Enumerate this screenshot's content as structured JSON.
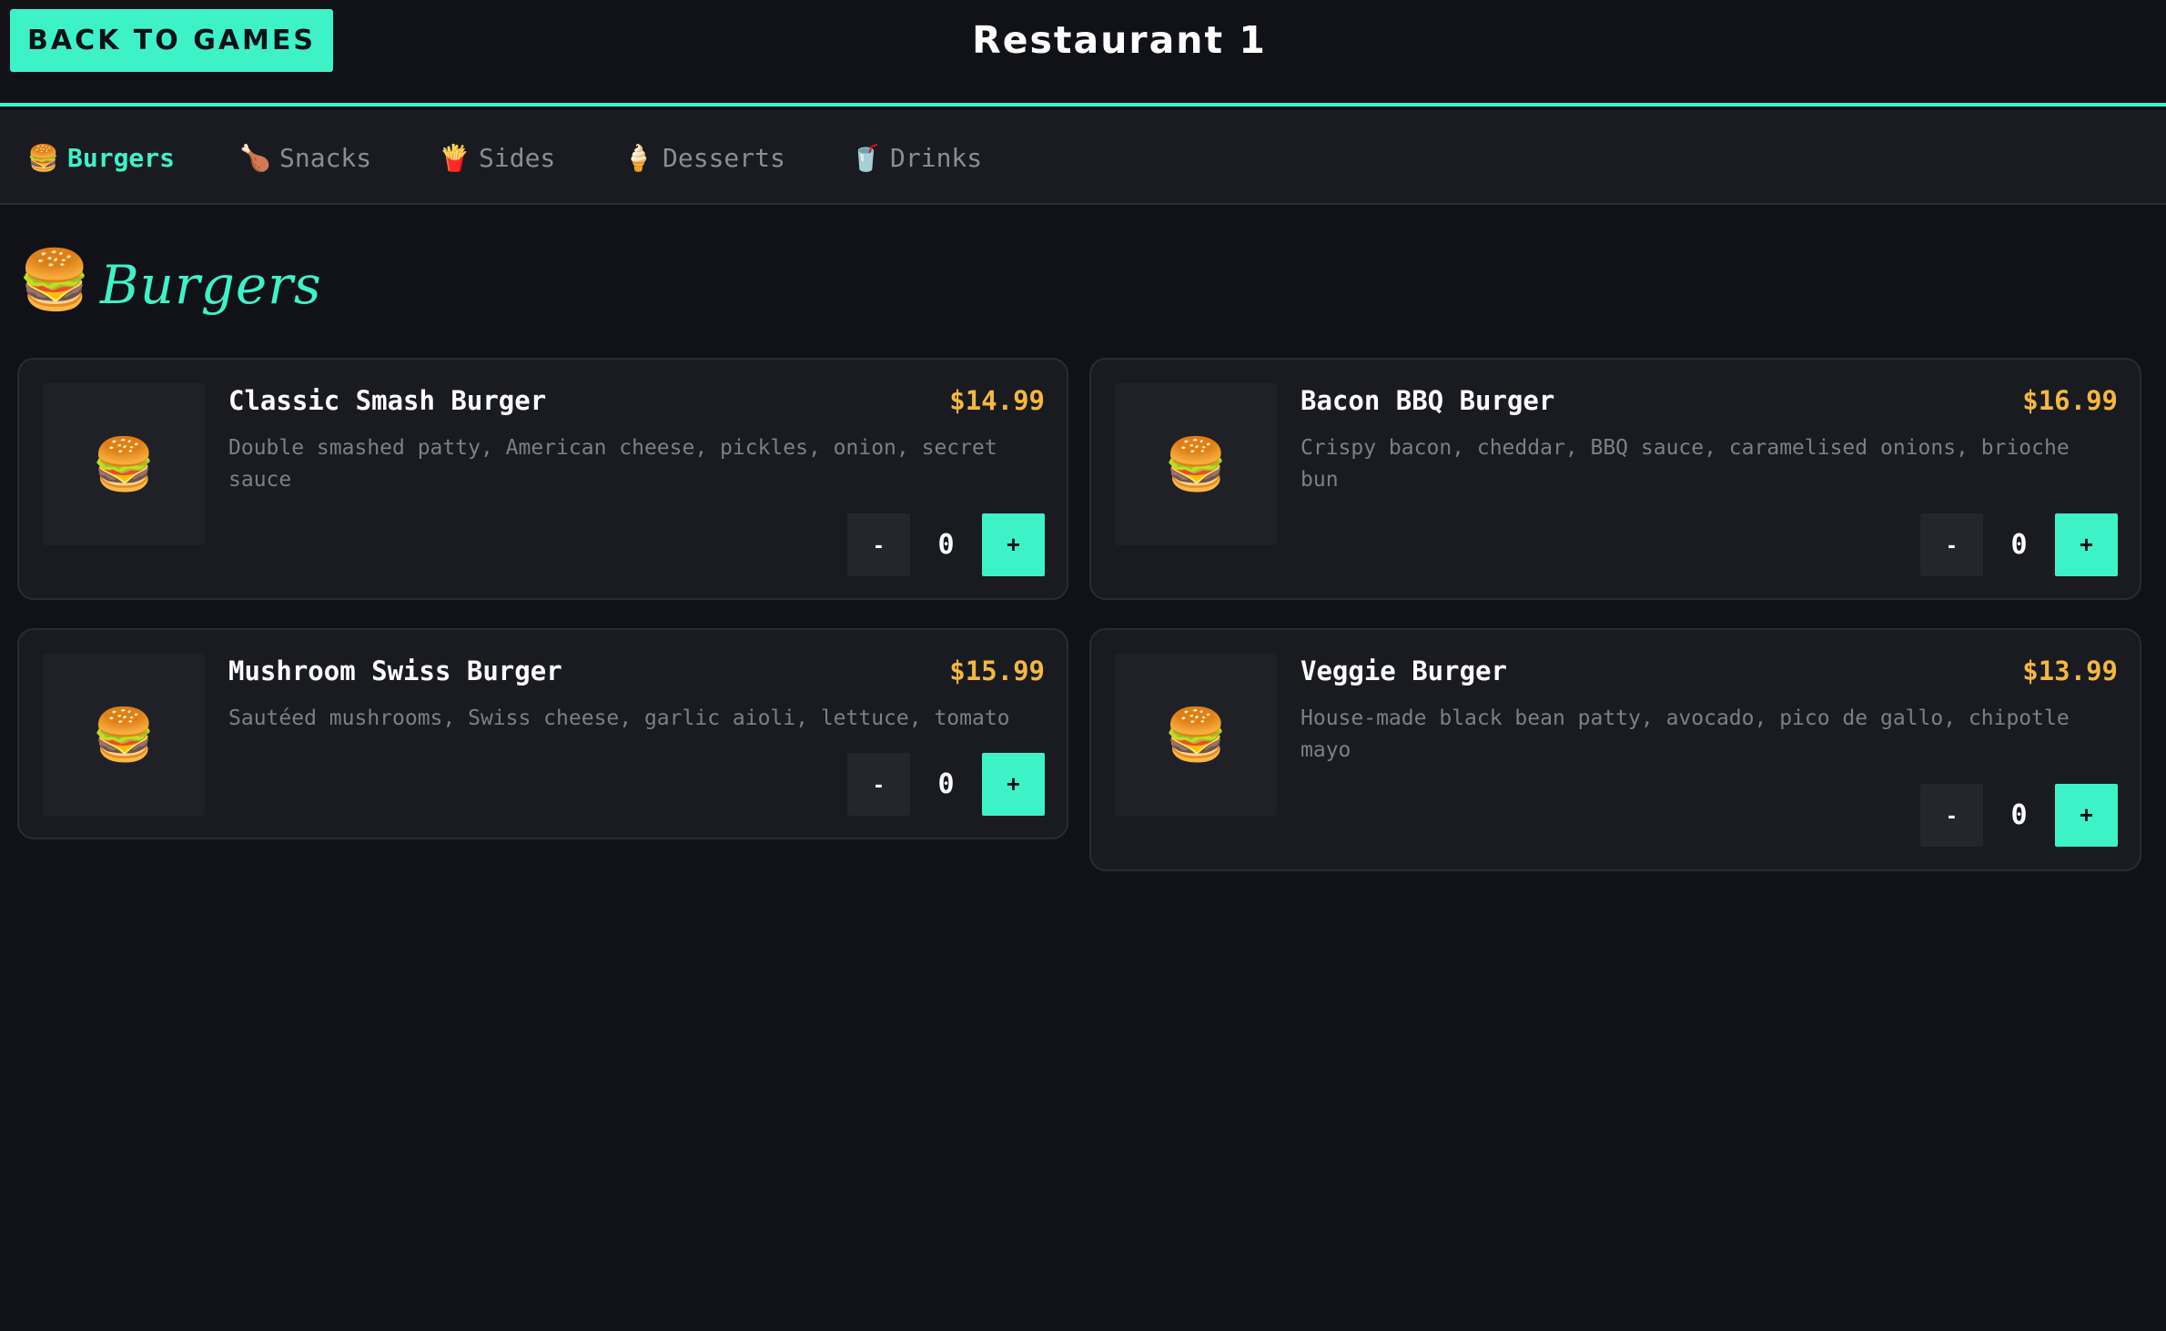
{
  "header": {
    "back_label": "BACK TO GAMES",
    "title": "Restaurant 1"
  },
  "tabs": [
    {
      "icon": "🍔",
      "label": "Burgers",
      "active": true
    },
    {
      "icon": "🍗",
      "label": "Snacks"
    },
    {
      "icon": "🍟",
      "label": "Sides"
    },
    {
      "icon": "🍦",
      "label": "Desserts"
    },
    {
      "icon": "🥤",
      "label": "Drinks"
    }
  ],
  "section": {
    "icon": "🍔",
    "title": "Burgers"
  },
  "items": [
    {
      "icon": "🍔",
      "name": "Classic Smash Burger",
      "price": "$14.99",
      "description": "Double smashed patty, American cheese, pickles, onion, secret sauce",
      "qty": "0",
      "minus": "-",
      "plus": "+"
    },
    {
      "icon": "🍔",
      "name": "Bacon BBQ Burger",
      "price": "$16.99",
      "description": "Crispy bacon, cheddar, BBQ sauce, caramelised onions, brioche bun",
      "qty": "0",
      "minus": "-",
      "plus": "+"
    },
    {
      "icon": "🍔",
      "name": "Mushroom Swiss Burger",
      "price": "$15.99",
      "description": "Sautéed mushrooms, Swiss cheese, garlic aioli, lettuce, tomato",
      "qty": "0",
      "minus": "-",
      "plus": "+"
    },
    {
      "icon": "🍔",
      "name": "Veggie Burger",
      "price": "$13.99",
      "description": "House-made black bean patty, avocado, pico de gallo, chipotle mayo",
      "qty": "0",
      "minus": "-",
      "plus": "+"
    }
  ],
  "colors": {
    "accent": "#3ef2c8",
    "price": "#f5b740",
    "background": "#111217",
    "card": "#1a1b21"
  }
}
